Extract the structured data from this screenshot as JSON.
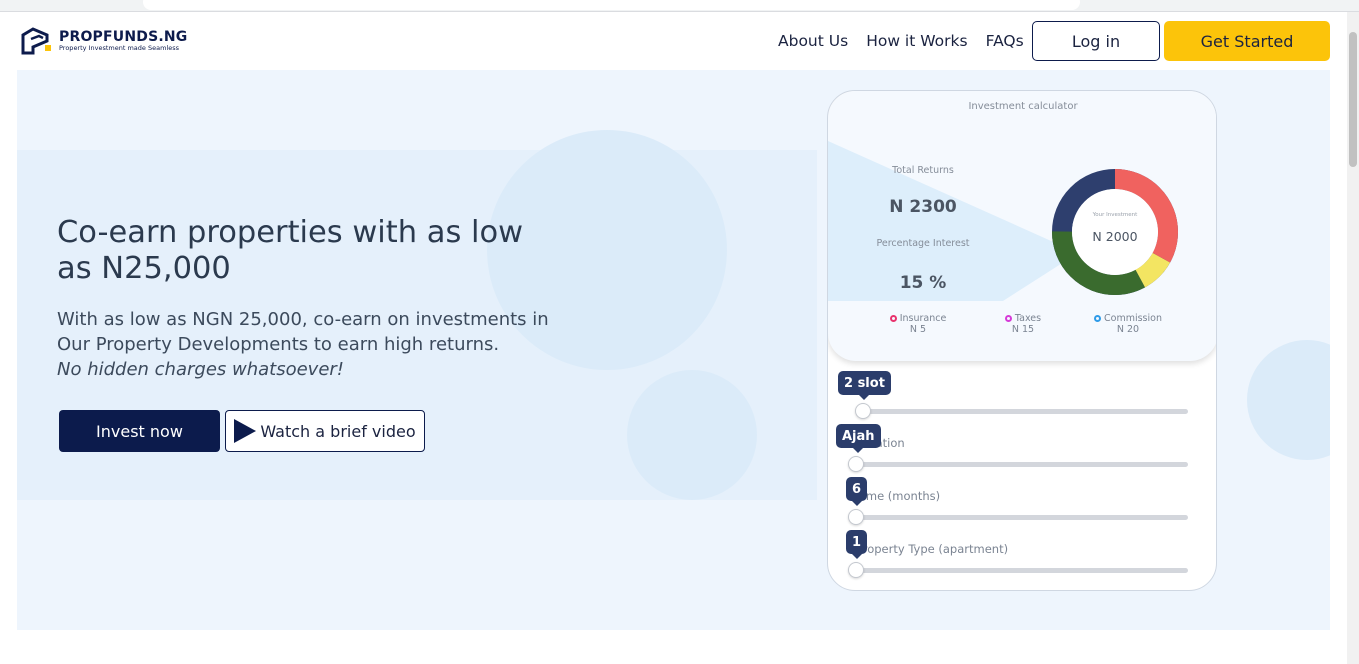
{
  "brand": {
    "name": "PROPFUNDS.NG",
    "tagline": "Property Investment made Seamless"
  },
  "nav": {
    "links": [
      "About Us",
      "How it Works",
      "FAQs"
    ],
    "login_label": "Log in",
    "get_started_label": "Get Started"
  },
  "hero": {
    "headline": "Co-earn properties with as low as N25,000",
    "subtext": "With as low as NGN 25,000, co-earn on investments in Our Property Developments to earn high returns.",
    "subtext_italic": "No hidden charges whatsoever!",
    "invest_label": "Invest now",
    "video_label": "Watch a brief video"
  },
  "calculator": {
    "title": "Investment calculator",
    "total_returns_label": "Total Returns",
    "total_returns_value": "N 2300",
    "percentage_label": "Percentage Interest",
    "percentage_value": "15 %",
    "center_label": "Your Investment",
    "center_value": "N 2000",
    "legend": [
      {
        "name": "Insurance",
        "value": "N 5",
        "color": "#e8336d"
      },
      {
        "name": "Taxes",
        "value": "N 15",
        "color": "#d63ad8"
      },
      {
        "name": "Commission",
        "value": "N 20",
        "color": "#2e9be8"
      }
    ],
    "donut_colors": {
      "red": "#f0625f",
      "yellow": "#f3e562",
      "green": "#3a6b2e",
      "navy": "#2e3f6e"
    },
    "sliders": [
      {
        "tooltip": "2 slot",
        "label": "",
        "position": 0.02
      },
      {
        "tooltip": "Ajah",
        "label": "Location",
        "position": 0.0
      },
      {
        "tooltip": "6",
        "label": "Time (months)",
        "position": 0.0
      },
      {
        "tooltip": "1",
        "label": "Property Type (apartment)",
        "position": 0.0
      }
    ]
  },
  "colors": {
    "accent_yellow": "#fcc40a",
    "navy": "#0c1b4c"
  }
}
